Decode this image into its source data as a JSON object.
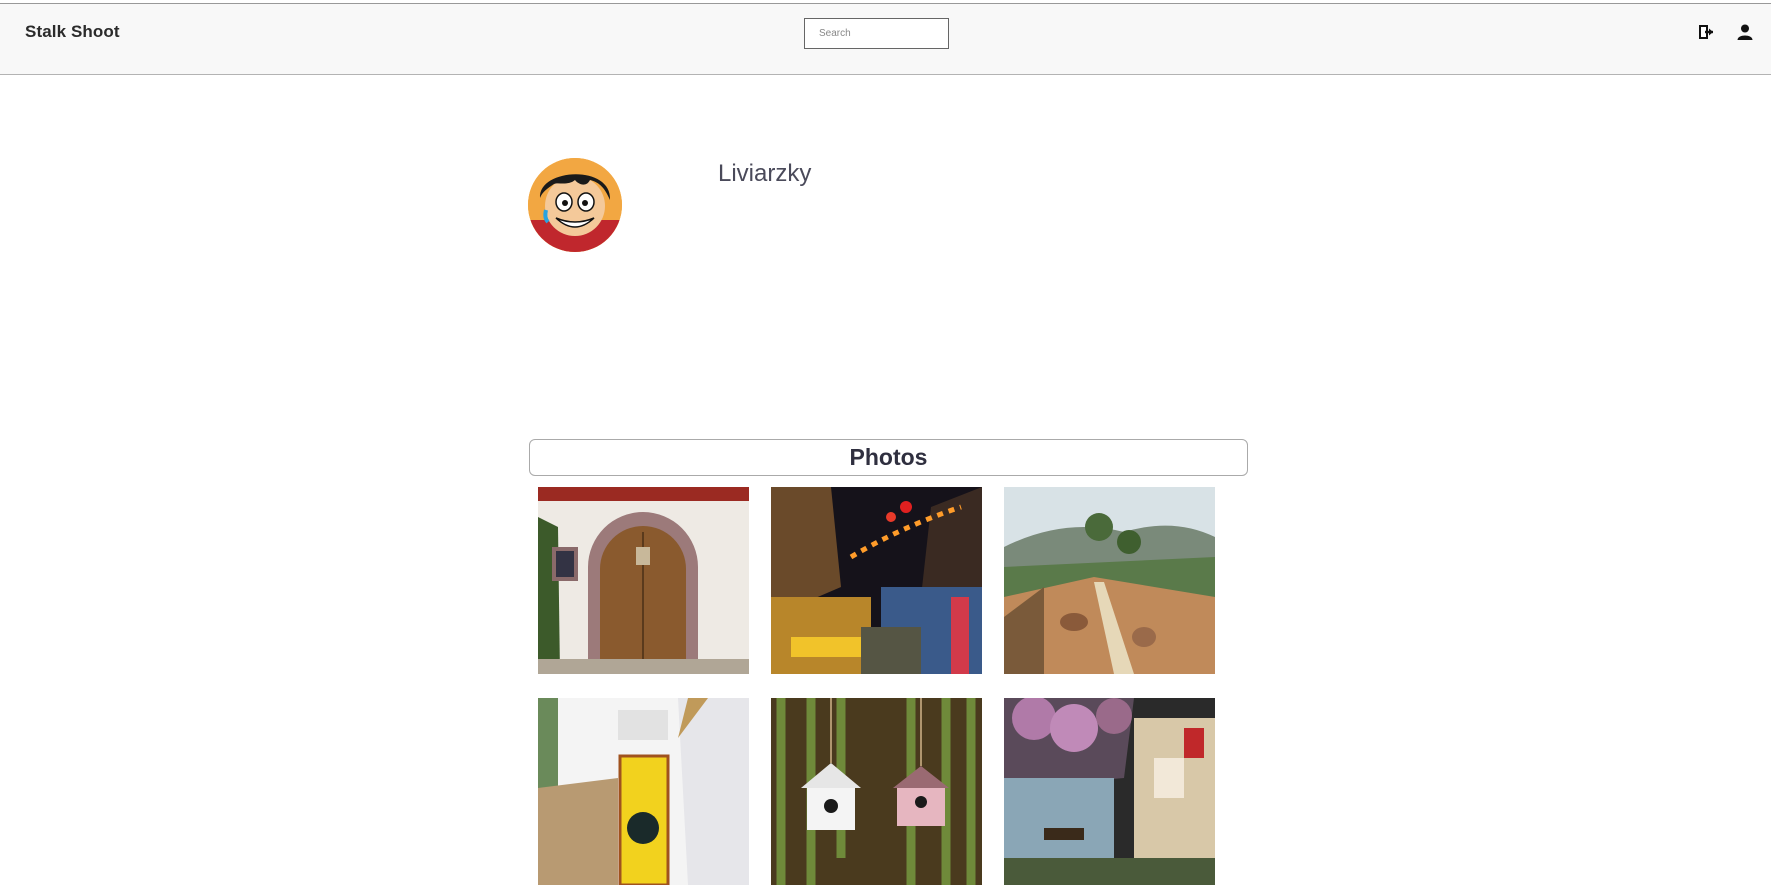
{
  "navbar": {
    "brand": "Stalk Shoot",
    "search_placeholder": "Search",
    "icons": [
      "exit-icon",
      "user-icon"
    ]
  },
  "profile": {
    "username": "Liviarzky",
    "avatar": "avatar-cartoon"
  },
  "photos_section": {
    "title": "Photos",
    "items": [
      {
        "name": "photo-arched-door"
      },
      {
        "name": "photo-night-market"
      },
      {
        "name": "photo-hill-garden"
      },
      {
        "name": "photo-yellow-door"
      },
      {
        "name": "photo-birdhouses"
      },
      {
        "name": "photo-flower-cafe"
      }
    ]
  }
}
